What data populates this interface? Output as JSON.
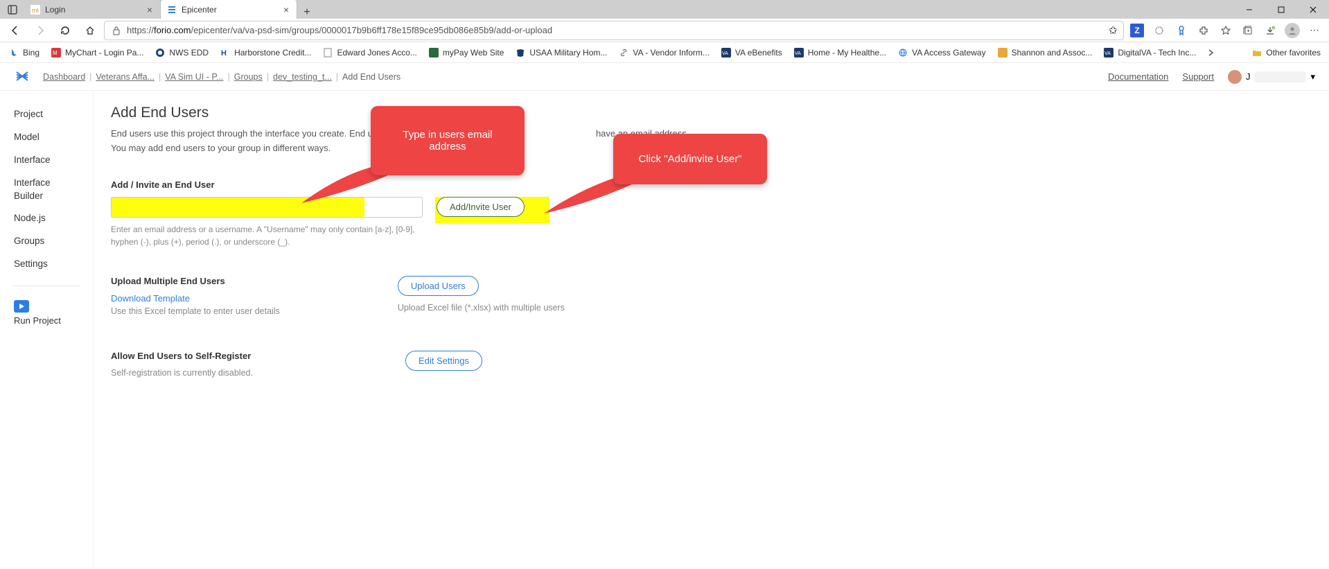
{
  "browser": {
    "tabs": [
      {
        "title": "Login",
        "favColor": "#d98b3a"
      },
      {
        "title": "Epicenter",
        "favColor": "#2f7de1"
      }
    ],
    "url": {
      "scheme": "https://",
      "host": "forio.com",
      "path": "/epicenter/va/va-psd-sim/groups/0000017b9b6ff178e15f89ce95db086e85b9/add-or-upload"
    },
    "bookmarks": [
      {
        "label": "Bing"
      },
      {
        "label": "MyChart - Login Pa..."
      },
      {
        "label": "NWS EDD"
      },
      {
        "label": "Harborstone Credit..."
      },
      {
        "label": "Edward Jones Acco..."
      },
      {
        "label": "myPay Web Site"
      },
      {
        "label": "USAA Military Hom..."
      },
      {
        "label": "VA - Vendor Inform..."
      },
      {
        "label": "VA eBenefits"
      },
      {
        "label": "Home - My Healthe..."
      },
      {
        "label": "VA Access Gateway"
      },
      {
        "label": "Shannon and Assoc..."
      },
      {
        "label": "DigitalVA - Tech Inc..."
      }
    ],
    "otherFavorites": "Other favorites"
  },
  "header": {
    "breadcrumbs": [
      "Dashboard",
      "Veterans Affa...",
      "VA Sim UI - P...",
      "Groups",
      "dev_testing_t..."
    ],
    "current": "Add End Users",
    "documentationLabel": "Documentation",
    "supportLabel": "Support",
    "userName": "J"
  },
  "sidebar": {
    "items": [
      "Project",
      "Model",
      "Interface",
      "Interface Builder",
      "Node.js",
      "Groups",
      "Settings"
    ],
    "runProject": "Run Project"
  },
  "main": {
    "title": "Add End Users",
    "desc1a": "End users use this project through the interface you create. End users belong to on",
    "desc1b": "have an email address.",
    "desc2": "You may add end users to your group in different ways.",
    "addInvite": {
      "heading": "Add / Invite an End User",
      "placeholder": "",
      "hint": "Enter an email address or a username. A \"Username\" may only contain [a-z], [0-9], hyphen (-), plus (+), period (.), or underscore (_).",
      "button": "Add/Invite User"
    },
    "upload": {
      "heading": "Upload Multiple End Users",
      "downloadLink": "Download Template",
      "hint": "Use this Excel template to enter user details",
      "button": "Upload Users",
      "buttonHint": "Upload Excel file (*.xlsx) with multiple users"
    },
    "selfReg": {
      "heading": "Allow End Users to Self-Register",
      "status": "Self-registration is currently disabled.",
      "button": "Edit Settings"
    }
  },
  "callouts": {
    "c1": "Type in users email address",
    "c2": "Click \"Add/invite User\""
  }
}
